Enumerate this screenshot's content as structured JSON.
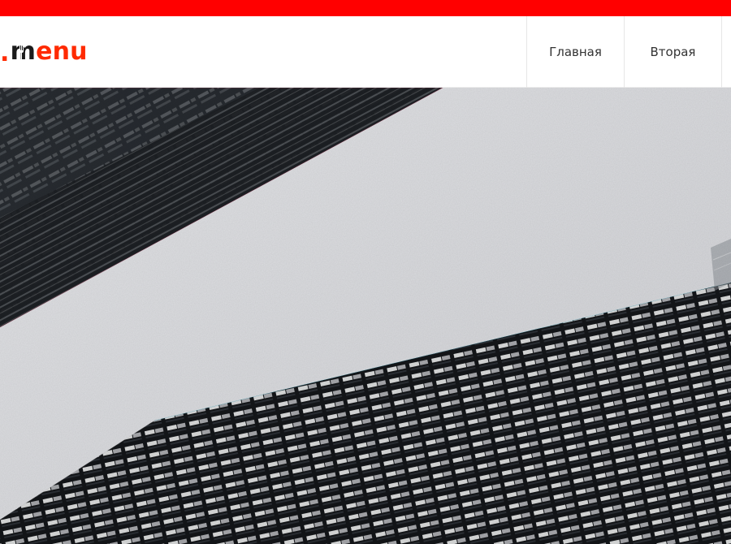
{
  "brand": {
    "logo_text": ".menu",
    "logo_dot": ".",
    "logo_m": "m",
    "logo_rest": "enu",
    "accent_color": "#ff2a00",
    "topbar_color": "#ff0000"
  },
  "nav": {
    "items": [
      {
        "label": "Главная"
      },
      {
        "label": "Вторая"
      }
    ]
  },
  "hero": {
    "image_label": "hero-image"
  }
}
